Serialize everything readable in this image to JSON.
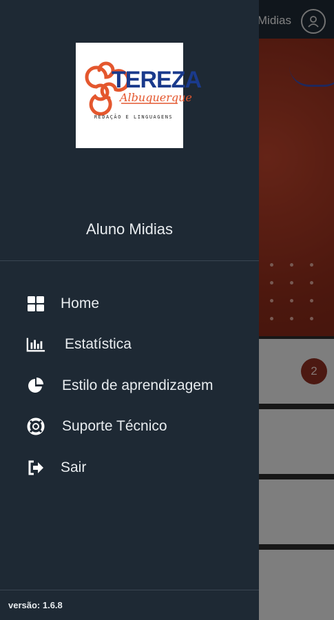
{
  "background": {
    "header_username": "Midias",
    "badge_count": "2"
  },
  "drawer": {
    "logo": {
      "name": "TEREZA",
      "surname": "Albuquerque",
      "tagline": "REDAÇÃO E LINGUAGENS"
    },
    "user_name": "Aluno Midias",
    "menu": [
      {
        "label": "Home",
        "icon": "grid-icon"
      },
      {
        "label": "Estatística",
        "icon": "bar-chart-icon"
      },
      {
        "label": "Estilo de aprendizagem",
        "icon": "pie-chart-icon"
      },
      {
        "label": "Suporte Técnico",
        "icon": "lifebuoy-icon"
      },
      {
        "label": "Sair",
        "icon": "sign-out-icon"
      }
    ],
    "version": "versão: 1.6.8"
  },
  "colors": {
    "drawer_bg": "#1e2934",
    "logo_blue": "#1a3a8c",
    "logo_orange": "#e4572e",
    "hero_red": "#b8422b"
  }
}
